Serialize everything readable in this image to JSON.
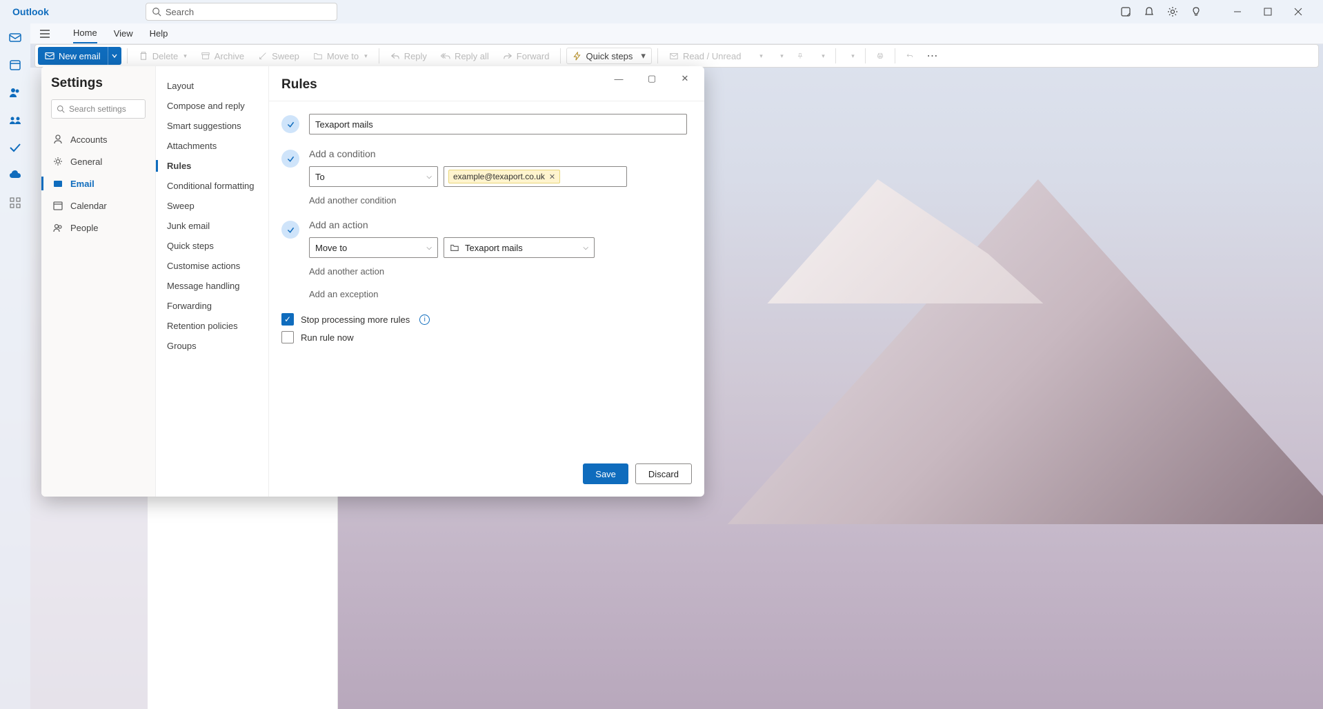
{
  "app": {
    "title": "Outlook",
    "search_placeholder": "Search"
  },
  "tabs": {
    "home": "Home",
    "view": "View",
    "help": "Help"
  },
  "ribbon": {
    "new_email": "New email",
    "delete": "Delete",
    "archive": "Archive",
    "sweep": "Sweep",
    "move_to": "Move to",
    "reply": "Reply",
    "reply_all": "Reply all",
    "forward": "Forward",
    "quick_steps": "Quick steps",
    "read_unread": "Read / Unread"
  },
  "settings": {
    "title": "Settings",
    "search_placeholder": "Search settings",
    "nav": {
      "accounts": "Accounts",
      "general": "General",
      "email": "Email",
      "calendar": "Calendar",
      "people": "People"
    },
    "subnav": {
      "layout": "Layout",
      "compose": "Compose and reply",
      "smart": "Smart suggestions",
      "attachments": "Attachments",
      "rules": "Rules",
      "conditional": "Conditional formatting",
      "sweep": "Sweep",
      "junk": "Junk email",
      "quick_steps": "Quick steps",
      "customise": "Customise actions",
      "message_handling": "Message handling",
      "forwarding": "Forwarding",
      "retention": "Retention policies",
      "groups": "Groups"
    }
  },
  "rules": {
    "heading": "Rules",
    "rule_name": "Texaport mails",
    "condition_label": "Add a condition",
    "condition_field": "To",
    "condition_value": "example@texaport.co.uk",
    "add_condition": "Add another condition",
    "action_label": "Add an action",
    "action_field": "Move to",
    "action_folder": "Texaport mails",
    "add_action": "Add another action",
    "add_exception": "Add an exception",
    "stop_processing": "Stop processing more rules",
    "run_now": "Run rule now",
    "save": "Save",
    "discard": "Discard"
  }
}
